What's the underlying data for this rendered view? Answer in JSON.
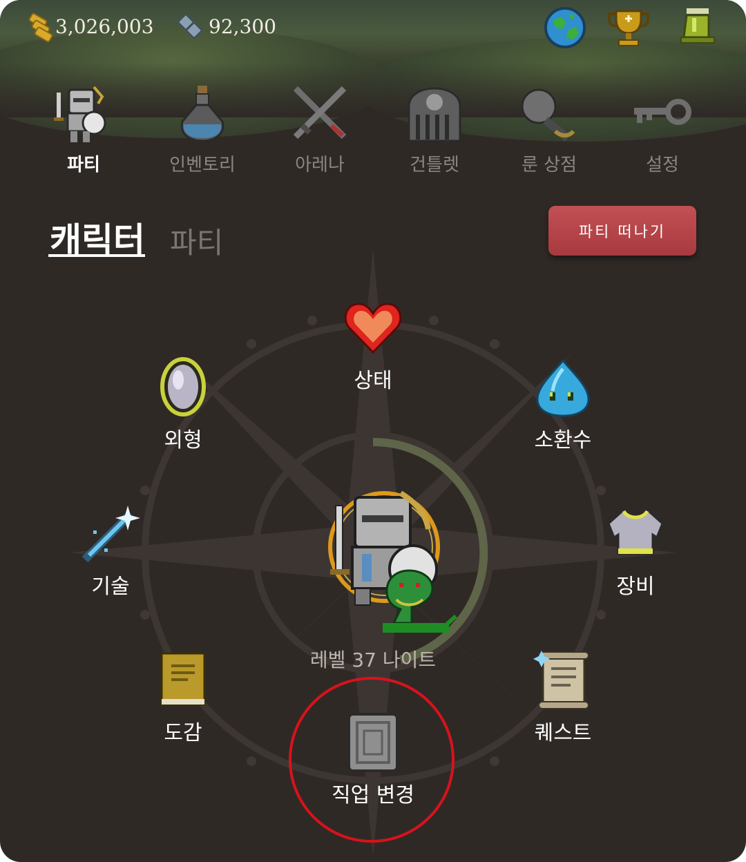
{
  "currency": {
    "gold": "3,026,003",
    "gems": "92,300"
  },
  "top_icons": [
    "globe-icon",
    "trophy-icon",
    "bell-icon"
  ],
  "nav": {
    "items": [
      {
        "label": "파티",
        "icon": "knight-icon",
        "active": true
      },
      {
        "label": "인벤토리",
        "icon": "potion-icon",
        "active": false
      },
      {
        "label": "아레나",
        "icon": "crossed-swords-icon",
        "active": false
      },
      {
        "label": "건틀렛",
        "icon": "gate-skull-icon",
        "active": false
      },
      {
        "label": "룬 상점",
        "icon": "rune-stone-icon",
        "active": false
      },
      {
        "label": "설정",
        "icon": "key-icon",
        "active": false
      }
    ]
  },
  "tabs": {
    "character": "캐릭터",
    "party": "파티"
  },
  "leave_button": "파티 떠나기",
  "menu": {
    "status": "상태",
    "appearance": "외형",
    "summon": "소환수",
    "skill": "기술",
    "equipment": "장비",
    "collection": "도감",
    "quest": "퀘스트",
    "class_change": "직업 변경"
  },
  "character": {
    "level_label": "레벨 37 나이트",
    "level_progress": 0.3
  },
  "colors": {
    "background": "#2f2926",
    "leave_button": "#b8444a",
    "highlight": "#d8121c"
  }
}
